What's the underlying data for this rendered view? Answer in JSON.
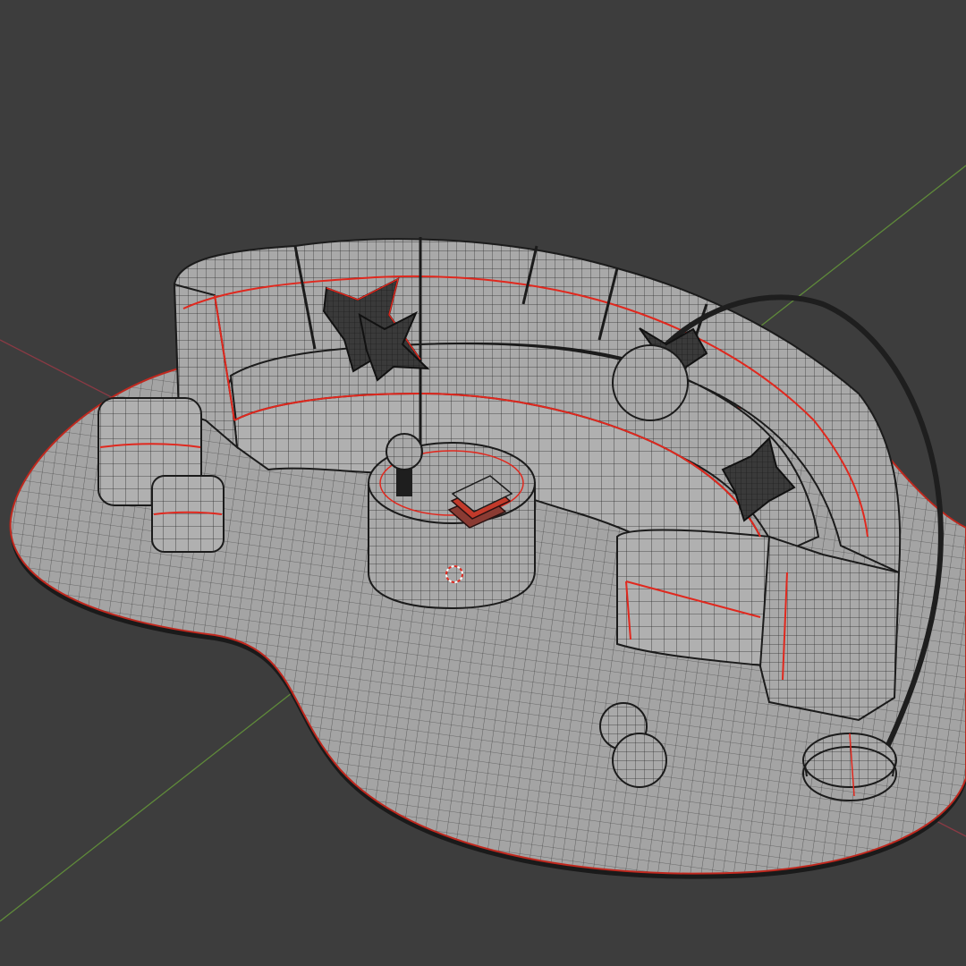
{
  "viewport": {
    "mode": "edit-wireframe",
    "background_color": "#3d3d3d",
    "mesh_fill_color": "#a9a9a9",
    "wire_color": "#2a2a2a",
    "seam_color": "#e0281e",
    "x_axis_color": "#8a3a44",
    "y_axis_color": "#5f8a3a"
  },
  "scene_objects": [
    {
      "name": "curved-sofa",
      "icon": "sofa-icon"
    },
    {
      "name": "floor-rug",
      "icon": "rug-icon"
    },
    {
      "name": "round-coffee-table",
      "icon": "table-icon"
    },
    {
      "name": "books-stack",
      "icon": "book-icon"
    },
    {
      "name": "small-table-lamp",
      "icon": "lamp-icon"
    },
    {
      "name": "arc-floor-lamp",
      "icon": "lamp-icon"
    },
    {
      "name": "ottoman-large",
      "icon": "cube-icon"
    },
    {
      "name": "ottoman-small",
      "icon": "cube-icon"
    },
    {
      "name": "pillow-1",
      "icon": "pillow-icon"
    },
    {
      "name": "pillow-2",
      "icon": "pillow-icon"
    },
    {
      "name": "pillow-3",
      "icon": "pillow-icon"
    },
    {
      "name": "decor-balls",
      "icon": "sphere-icon"
    },
    {
      "name": "3d-cursor",
      "icon": "crosshair-icon"
    }
  ]
}
